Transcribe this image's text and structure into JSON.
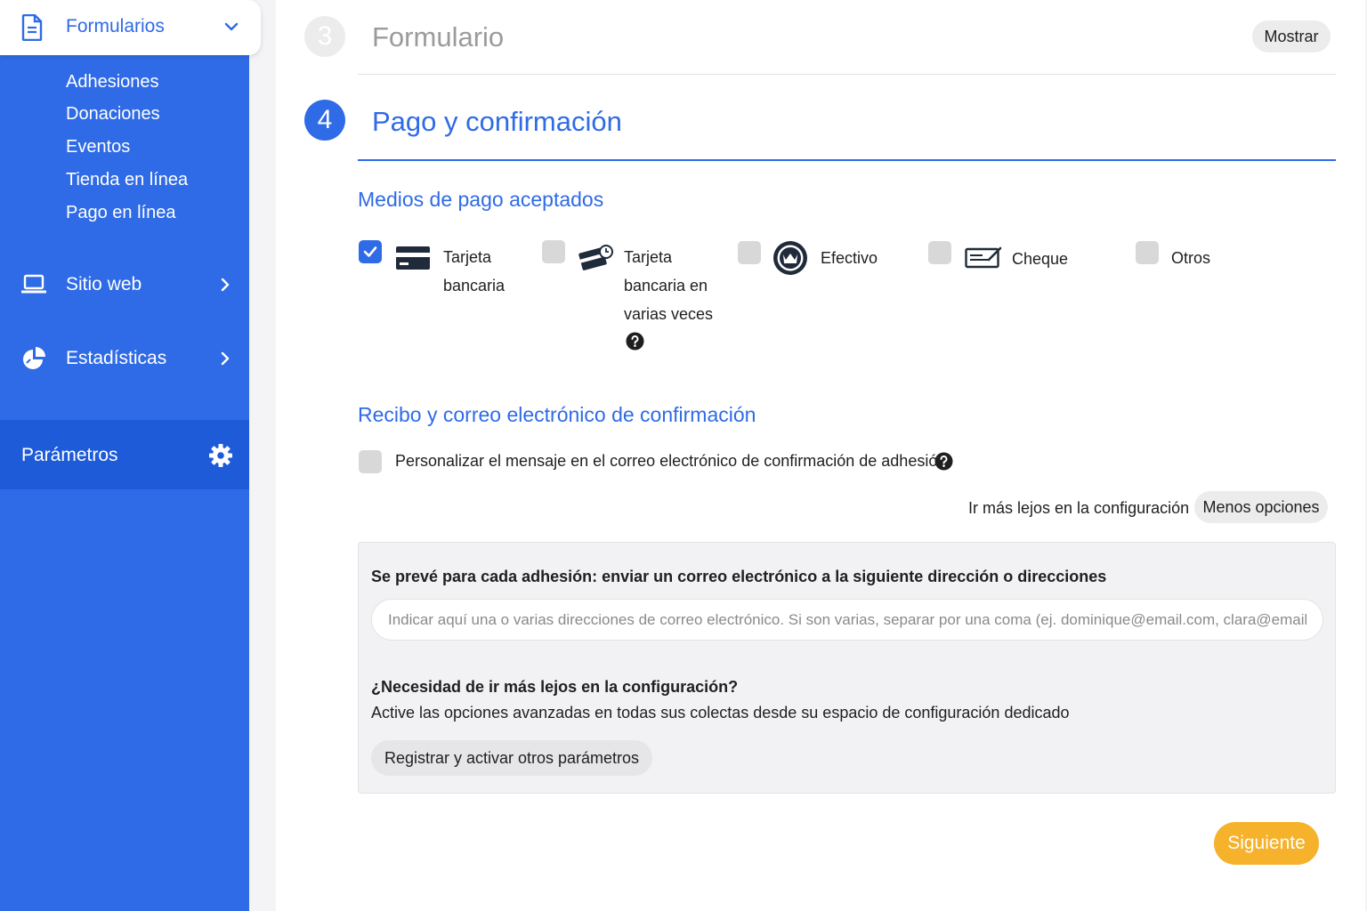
{
  "sidebar": {
    "forms_label": "Formularios",
    "sub_items": [
      "Adhesiones",
      "Donaciones",
      "Eventos",
      "Tienda en línea",
      "Pago en línea"
    ],
    "website_label": "Sitio web",
    "stats_label": "Estadísticas",
    "params_label": "Parámetros"
  },
  "steps": {
    "step3": {
      "number": "3",
      "title": "Formulario",
      "button": "Mostrar"
    },
    "step4": {
      "number": "4",
      "title": "Pago y confirmación"
    }
  },
  "payment": {
    "title": "Medios de pago aceptados",
    "methods": [
      {
        "line1": "Tarjeta",
        "line2": "bancaria",
        "checked": true,
        "icon": "credit-card-icon"
      },
      {
        "line1": "Tarjeta",
        "line2": "bancaria en",
        "line3": "varias veces",
        "checked": false,
        "icon": "card-recurring-icon"
      },
      {
        "line1": "Efectivo",
        "checked": false,
        "icon": "cash-coin-icon"
      },
      {
        "line1": "Cheque",
        "checked": false,
        "icon": "cheque-icon"
      },
      {
        "line1": "Otros",
        "checked": false
      }
    ]
  },
  "receipt": {
    "title": "Recibo y correo electrónico de confirmación",
    "customize_label": "Personalizar el mensaje en el correo electrónico de confirmación de adhesión",
    "more_config_text": "Ir más lejos en la configuración",
    "less_options_button": "Menos opciones",
    "box_heading": "Se prevé para cada adhesión: enviar un correo electrónico a la siguiente dirección o direcciones",
    "email_placeholder": "Indicar aquí una o varias direcciones de correo electrónico. Si son varias, separar por una coma (ej. dominique@email.com, clara@email.com)",
    "need_more_heading": "¿Necesidad de ir más lejos en la configuración?",
    "need_more_text": "Active las opciones avanzadas en todas sus colectas desde su espacio de configuración dedicado",
    "register_button": "Registrar y activar otros parámetros"
  },
  "next_button": "Siguiente",
  "colors": {
    "primary": "#2f6be6",
    "accent": "#f5b22a"
  }
}
